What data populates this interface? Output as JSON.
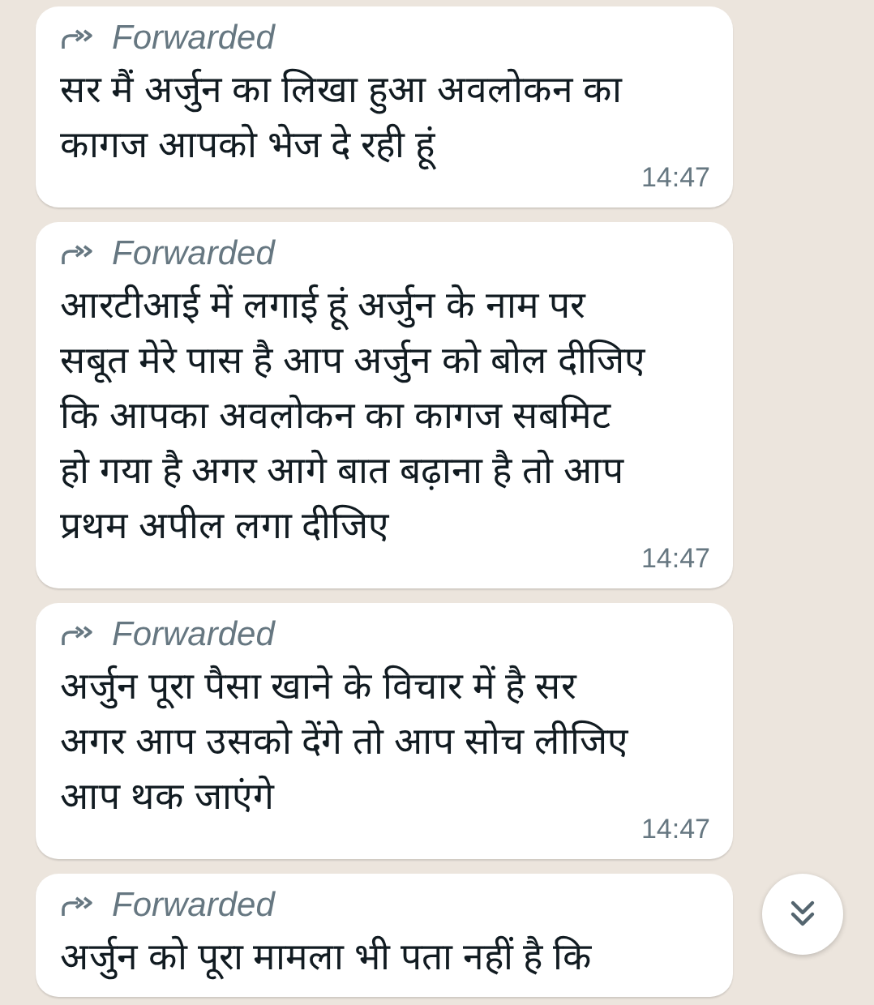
{
  "messages": [
    {
      "forwarded_label": "Forwarded",
      "lines": [
        "सर मैं अर्जुन का लिखा हुआ अवलोकन का",
        "कागज आपको भेज दे रही हूं"
      ],
      "time": "14:47"
    },
    {
      "forwarded_label": "Forwarded",
      "lines": [
        "आरटीआई में लगाई हूं अर्जुन के नाम पर",
        "सबूत मेरे पास है आप अर्जुन को बोल दीजिए",
        "कि आपका अवलोकन का कागज सबमिट",
        "हो गया है अगर आगे बात बढ़ाना है तो आप",
        "प्रथम अपील लगा दीजिए"
      ],
      "time": "14:47"
    },
    {
      "forwarded_label": "Forwarded",
      "lines": [
        "अर्जुन पूरा पैसा खाने के विचार में है सर",
        "अगर आप उसको देंगे तो आप सोच लीजिए",
        "आप थक जाएंगे"
      ],
      "time": "14:47"
    },
    {
      "forwarded_label": "Forwarded",
      "lines": [
        "अर्जुन को पूरा मामला भी पता नहीं है कि"
      ]
    }
  ]
}
